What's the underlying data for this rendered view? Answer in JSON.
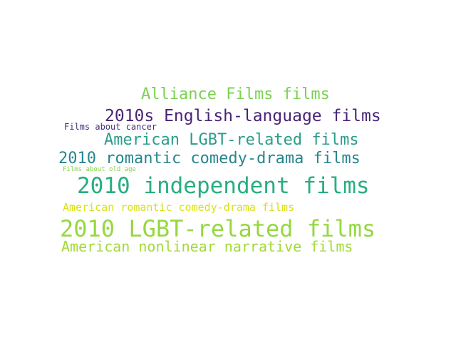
{
  "words": [
    {
      "text": "Alliance Films films",
      "color": "#7ad151"
    },
    {
      "text": "2010s English-language films",
      "color": "#482475"
    },
    {
      "text": "Films about cancer",
      "color": "#472d7b"
    },
    {
      "text": "American LGBT-related films",
      "color": "#2a9d8a"
    },
    {
      "text": "2010 romantic comedy-drama films",
      "color": "#27858e"
    },
    {
      "text": "Films about old age",
      "color": "#84d44b"
    },
    {
      "text": "2010 independent films",
      "color": "#28ae80"
    },
    {
      "text": "American romantic comedy-drama films",
      "color": "#d8e219"
    },
    {
      "text": "2010 LGBT-related films",
      "color": "#95d840"
    },
    {
      "text": "American nonlinear narrative films",
      "color": "#a2da37"
    }
  ]
}
